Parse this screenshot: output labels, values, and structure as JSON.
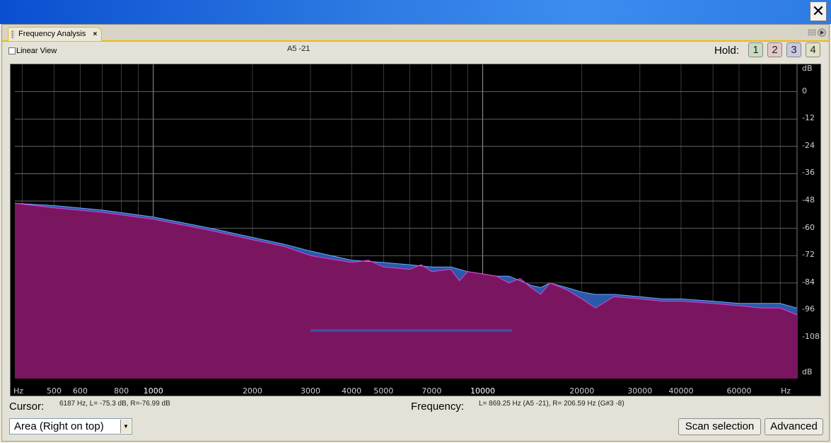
{
  "window": {
    "close_glyph": "✕"
  },
  "tab": {
    "title": "Frequency Analysis",
    "close_glyph": "×"
  },
  "toolbar": {
    "linear_view_label": "Linear View",
    "linear_view_checked": false,
    "note_readout": "A5 -21",
    "hold_label": "Hold:",
    "hold_buttons": [
      {
        "label": "1",
        "color": "#C9DCC0"
      },
      {
        "label": "2",
        "color": "#E3C9C9"
      },
      {
        "label": "3",
        "color": "#C9C9E3"
      },
      {
        "label": "4",
        "color": "#E3E1C3"
      }
    ]
  },
  "graph": {
    "x_unit_left": "Hz",
    "x_unit_right": "Hz",
    "x_ticks": [
      "500",
      "600",
      "800",
      "1000",
      "2000",
      "3000",
      "4000",
      "5000",
      "7000",
      "10000",
      "20000",
      "30000",
      "40000",
      "60000"
    ],
    "y_unit_top": "dB",
    "y_unit_bottom": "dB",
    "y_ticks": [
      "0",
      "-12",
      "-24",
      "-36",
      "-48",
      "-60",
      "-72",
      "-84",
      "-96",
      "-108"
    ]
  },
  "chart_data": {
    "type": "area",
    "xlabel": "Hz",
    "ylabel": "dB",
    "x_scale": "log",
    "xlim": [
      380,
      90000
    ],
    "ylim": [
      -126,
      12
    ],
    "grid": true,
    "colors": {
      "left": "#2A5AA8",
      "right": "#7A1660",
      "right_line": "#E040D0",
      "left_line": "#6FA8FF",
      "background": "#000000"
    },
    "series": [
      {
        "x": [
          380,
          500,
          700,
          1000,
          1500,
          2000,
          2500,
          3000,
          4000,
          5000,
          6000,
          7000,
          8000,
          9000,
          10000,
          11000,
          12000,
          13000,
          14000,
          15000,
          16000,
          18000,
          20000,
          22000,
          25000,
          30000,
          35000,
          40000,
          50000,
          60000,
          70000,
          80000,
          90000
        ],
        "y": [
          -49,
          -50,
          -52,
          -55,
          -60,
          -64,
          -67,
          -70,
          -74,
          -75,
          -76,
          -77,
          -77,
          -79,
          -80,
          -81,
          -81,
          -83,
          -85,
          -86,
          -84,
          -86,
          -88,
          -89,
          -89,
          -90,
          -91,
          -91,
          -92,
          -93,
          -93,
          -93,
          -95
        ]
      },
      {
        "x": [
          380,
          500,
          700,
          1000,
          1500,
          2000,
          2500,
          3000,
          4000,
          4500,
          5000,
          6000,
          6500,
          7000,
          8000,
          8500,
          9000,
          10000,
          11000,
          12000,
          13000,
          14000,
          15000,
          16000,
          18000,
          20000,
          22000,
          25000,
          30000,
          35000,
          40000,
          50000,
          60000,
          70000,
          80000,
          90000
        ],
        "y": [
          -49,
          -51,
          -53,
          -56,
          -61,
          -65,
          -68,
          -72,
          -75,
          -74,
          -77,
          -78,
          -76,
          -79,
          -78,
          -83,
          -79,
          -80,
          -81,
          -84,
          -82,
          -86,
          -89,
          -84,
          -87,
          -91,
          -95,
          -90,
          -91,
          -92,
          -92,
          -93,
          -94,
          -95,
          -95,
          -98
        ]
      }
    ]
  },
  "readouts": {
    "cursor_label": "Cursor:",
    "cursor_value": "6187 Hz, L= -75.3 dB, R=-76.99 dB",
    "frequency_label": "Frequency:",
    "frequency_value": "L= 869.25 Hz (A5 -21), R= 206.59 Hz (G#3 -8)"
  },
  "controls": {
    "display_mode": "Area (Right on top)",
    "scan_selection_label": "Scan selection",
    "advanced_label": "Advanced"
  }
}
